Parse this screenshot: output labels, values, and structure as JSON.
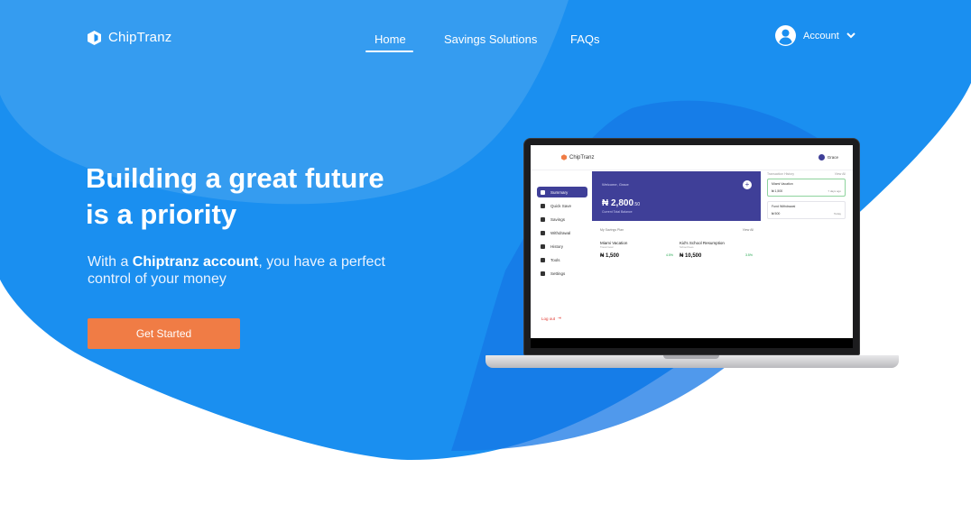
{
  "brand": {
    "name": "ChipTranz"
  },
  "nav": {
    "links": [
      "Home",
      "Savings Solutions",
      "FAQs"
    ],
    "active": "Home",
    "account_label": "Account"
  },
  "hero": {
    "title_line1": "Building a great future",
    "title_line2": "is a priority",
    "subtitle_prefix": "With a ",
    "subtitle_bold": "Chiptranz account",
    "subtitle_suffix": ", you have a perfect control of your money",
    "cta_label": "Get Started"
  },
  "colors": {
    "primary_blue": "#1a8ff0",
    "light_blue": "#3aa2f0",
    "cta_orange": "#f07c45",
    "dashboard_purple": "#3f3f98"
  },
  "dashboard": {
    "brand": "ChipTranz",
    "user": "Grace",
    "welcome": "Welcome, Grace",
    "balance": "₦ 2,800",
    "balance_decimals": ".50",
    "balance_label": "Current Total Balance",
    "sidebar": [
      "Summary",
      "Quick Save",
      "Savings",
      "Withdrawal",
      "History",
      "Tools",
      "Settings"
    ],
    "logout": "Log out",
    "plans_header": "My Savings Plan",
    "plans_view_all": "View All",
    "plans": [
      {
        "name": "Miami Vacation",
        "sub": "Travel Goal",
        "amount": "₦ 1,500",
        "percent": "4.5%",
        "amount_label": "Current Savings Balance",
        "percent_label": "interest p.a."
      },
      {
        "name": "Kid's School Resumption",
        "sub": "School Fees",
        "amount": "₦ 10,500",
        "percent": "3.5%",
        "amount_label": "Current Savings Balance",
        "percent_label": "interest p.a."
      }
    ],
    "trans_header": "Transaction History",
    "trans_view_all": "View All",
    "transactions": [
      {
        "title": "Miami Vacation",
        "amount": "₦ 1,500",
        "date": "7 days ago"
      },
      {
        "title": "Fund Withdrawal",
        "amount": "₦ 500",
        "date": "Today"
      }
    ]
  }
}
